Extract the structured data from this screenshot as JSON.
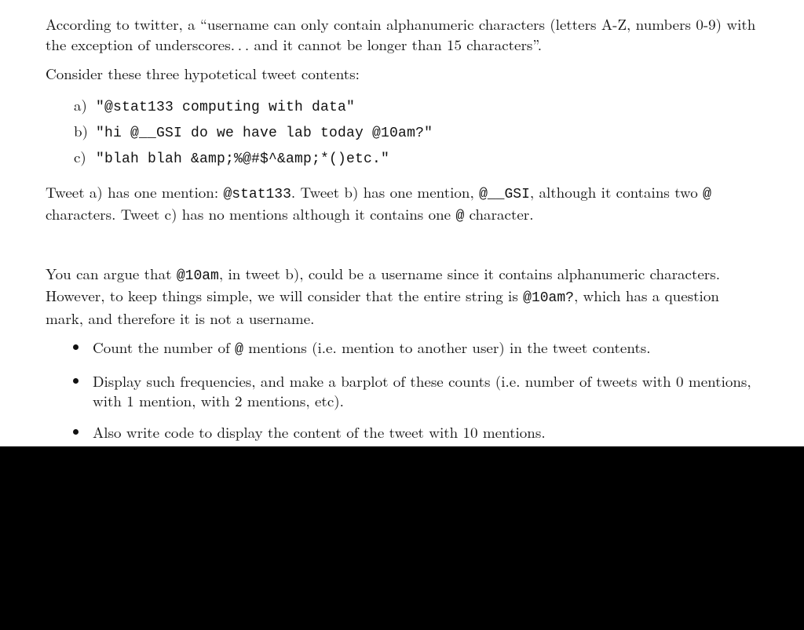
{
  "para1_a": "According to twitter, a “username can only contain alphanumeric characters (letters A-Z, numbers 0-9) with the exception of underscores. . . and it cannot be longer than 15 characters”.",
  "para2": "Consider these three hypotetical tweet contents:",
  "ex": {
    "a_lbl": "a)",
    "a_txt": "\"@stat133 computing with data\"",
    "b_lbl": "b)",
    "b_txt": "\"hi @__GSI do we have lab today @10am?\"",
    "c_lbl": "c)",
    "c_txt": "\"blah blah &amp;%@#$^&amp;*()etc.\""
  },
  "para3_a": "Tweet a) has one mention: ",
  "para3_b": "@stat133",
  "para3_c": ". Tweet b) has one mention, ",
  "para3_d": "@__GSI",
  "para3_e": ", although it contains two ",
  "para3_f": "@",
  "para3_g": " characters. Tweet c) has no mentions although it contains one ",
  "para3_h": "@",
  "para3_i": " character.",
  "para4_a": "You can argue that ",
  "para4_b": "@10am",
  "para4_c": ", in tweet b), could be a username since it contains alphanumeric characters. However, to keep things simple, we will consider that the entire string is ",
  "para4_d": "@10am?",
  "para4_e": ", which has a question mark, and therefore it is not a username.",
  "bullets": {
    "b1_a": "Count the number of ",
    "b1_b": "@",
    "b1_c": " mentions (i.e. mention to another user) in the tweet contents.",
    "b2": "Display such frequencies, and make a barplot of these counts (i.e. number of tweets with 0 mentions, with 1 mention, with 2 mentions, etc).",
    "b3": "Also write code to display the content of the tweet with 10 mentions."
  }
}
